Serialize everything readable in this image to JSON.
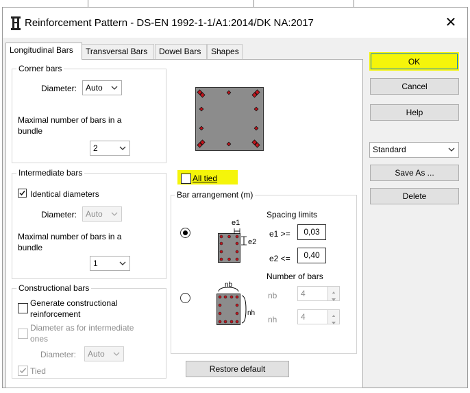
{
  "window": {
    "title": "Reinforcement Pattern - DS-EN 1992-1-1/A1:2014/DK NA:2017",
    "close_label": "✕"
  },
  "tabs": [
    {
      "label": "Longitudinal Bars",
      "active": true
    },
    {
      "label": "Transversal Bars",
      "active": false
    },
    {
      "label": "Dowel Bars",
      "active": false
    },
    {
      "label": "Shapes",
      "active": false
    }
  ],
  "corner_bars": {
    "title": "Corner bars",
    "diameter_label": "Diameter:",
    "diameter_value": "Auto",
    "max_bars_label_line1": "Maximal number of bars in a",
    "max_bars_label_line2": "bundle",
    "max_bars_value": "2"
  },
  "intermediate_bars": {
    "title": "Intermediate bars",
    "identical_label": "Identical diameters",
    "identical_checked": true,
    "diameter_label": "Diameter:",
    "diameter_value": "Auto",
    "max_bars_label_line1": "Maximal number of bars in a",
    "max_bars_label_line2": "bundle",
    "max_bars_value": "1"
  },
  "constructional_bars": {
    "title": "Constructional bars",
    "generate_label_line1": "Generate constructional",
    "generate_label_line2": "reinforcement",
    "generate_checked": false,
    "diameter_as_label_line1": "Diameter as for intermediate",
    "diameter_as_label_line2": "ones",
    "diameter_label": "Diameter:",
    "diameter_value": "Auto",
    "tied_label": "Tied",
    "tied_checked": true
  },
  "all_tied": {
    "label": "All tied",
    "checked": false,
    "highlight_color": "#f5f50a"
  },
  "bar_arrangement": {
    "title": "Bar arrangement (m)",
    "selected_option": "spacing",
    "spacing_limits_label": "Spacing limits",
    "e1_label": "e1 >=",
    "e1_value": "0,03",
    "e2_label": "e2 <=",
    "e2_value": "0,40",
    "diagram_e1": "e1",
    "diagram_e2": "e2",
    "number_of_bars_label": "Number of bars",
    "nb_label": "nb",
    "nb_value": "4",
    "nh_label": "nh",
    "nh_value": "4",
    "diagram_nb": "nb",
    "diagram_nh": "nh"
  },
  "restore_default_label": "Restore default",
  "buttons": {
    "ok": "OK",
    "cancel": "Cancel",
    "help": "Help",
    "save_as": "Save As ...",
    "delete": "Delete"
  },
  "preset": {
    "value": "Standard"
  },
  "colors": {
    "highlight": "#f5f50a",
    "bar_red": "#c0141c",
    "section_gray": "#8c8c8c"
  }
}
